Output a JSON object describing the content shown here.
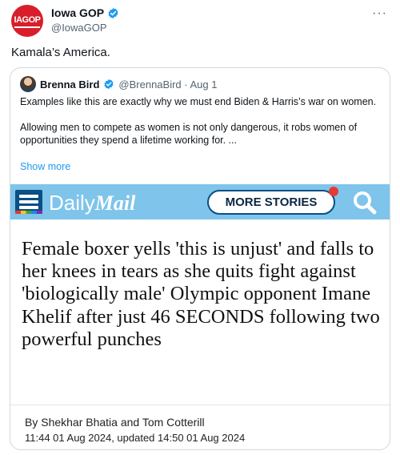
{
  "tweet": {
    "avatar_text": "IAGOP",
    "display_name": "Iowa GOP",
    "handle": "@IowaGOP",
    "more_glyph": "···",
    "text": "Kamala’s America."
  },
  "quote": {
    "display_name": "Brenna Bird",
    "handle_date": "@BrennaBird · Aug 1",
    "paragraph1": "Examples like this are exactly why we must end Biden & Harris’s war on women.",
    "paragraph2": "Allowing men to compete as women is not only dangerous, it robs women of opportunities they spend a lifetime working for. ...",
    "show_more": "Show more"
  },
  "article": {
    "logo_daily": "Daily",
    "logo_mail": "Mail",
    "more_stories": "MORE STORIES",
    "headline": "Female boxer yells 'this is unjust' and falls to her knees in tears as she quits fight against 'biologically male' Olympic opponent Imane Khelif after just 46 SECONDS following two powerful punches",
    "byline": "By Shekhar Bhatia and Tom Cotterill",
    "dateline": "11:44 01 Aug 2024, updated 14:50 01 Aug 2024"
  },
  "colors": {
    "verified": "#1d9bf0",
    "link": "#1d9bf0",
    "dm_bar": "#7fc4ea",
    "dm_dark": "#0a4f86"
  },
  "icons": [
    "verified-badge-icon",
    "more-options-icon",
    "hamburger-menu-icon",
    "search-icon"
  ]
}
